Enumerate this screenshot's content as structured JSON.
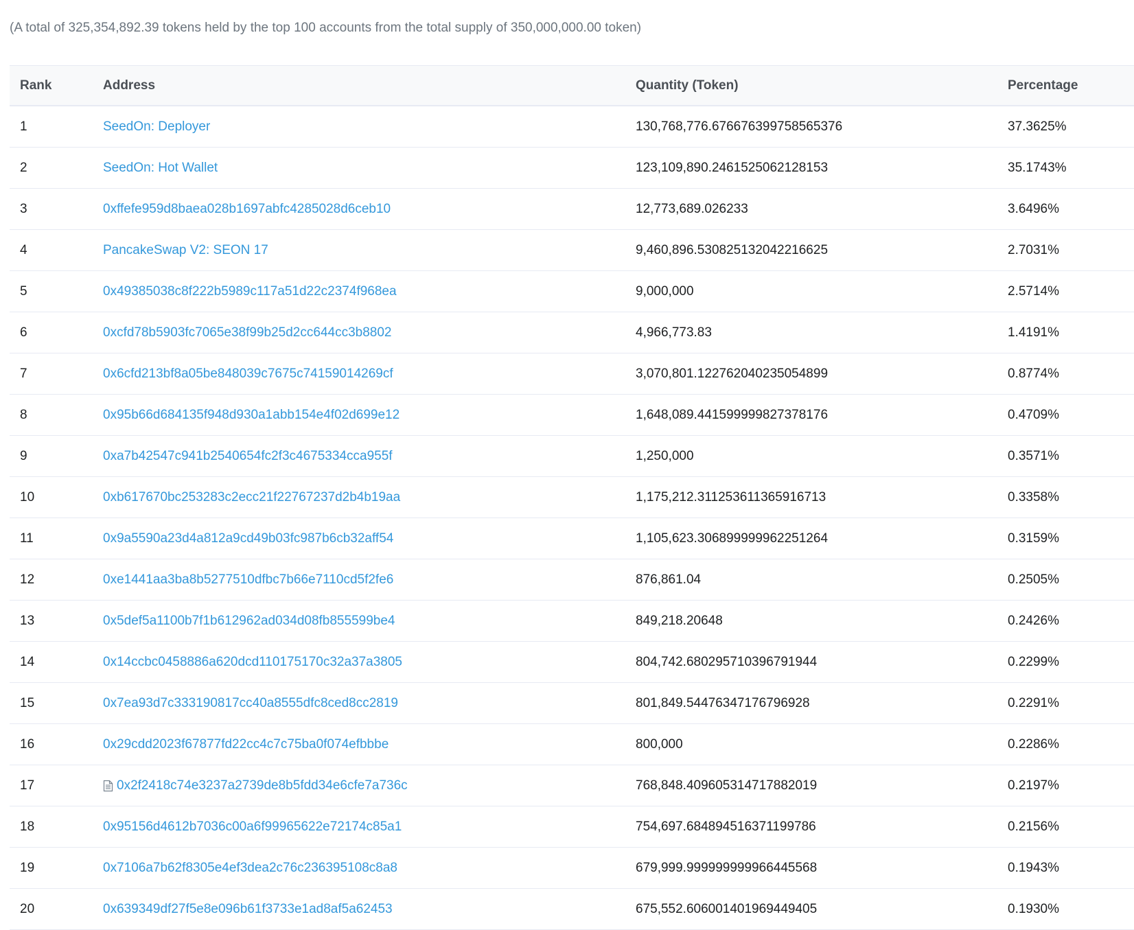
{
  "summary": "(A total of 325,354,892.39 tokens held by the top 100 accounts from the total supply of 350,000,000.00 token)",
  "table": {
    "headers": {
      "rank": "Rank",
      "address": "Address",
      "quantity": "Quantity (Token)",
      "percentage": "Percentage"
    },
    "rows": [
      {
        "rank": "1",
        "address": "SeedOn: Deployer",
        "quantity": "130,768,776.676676399758565376",
        "percentage": "37.3625%",
        "icon": ""
      },
      {
        "rank": "2",
        "address": "SeedOn: Hot Wallet",
        "quantity": "123,109,890.2461525062128153",
        "percentage": "35.1743%",
        "icon": ""
      },
      {
        "rank": "3",
        "address": "0xffefe959d8baea028b1697abfc4285028d6ceb10",
        "quantity": "12,773,689.026233",
        "percentage": "3.6496%",
        "icon": ""
      },
      {
        "rank": "4",
        "address": "PancakeSwap V2: SEON 17",
        "quantity": "9,460,896.530825132042216625",
        "percentage": "2.7031%",
        "icon": ""
      },
      {
        "rank": "5",
        "address": "0x49385038c8f222b5989c117a51d22c2374f968ea",
        "quantity": "9,000,000",
        "percentage": "2.5714%",
        "icon": ""
      },
      {
        "rank": "6",
        "address": "0xcfd78b5903fc7065e38f99b25d2cc644cc3b8802",
        "quantity": "4,966,773.83",
        "percentage": "1.4191%",
        "icon": ""
      },
      {
        "rank": "7",
        "address": "0x6cfd213bf8a05be848039c7675c74159014269cf",
        "quantity": "3,070,801.122762040235054899",
        "percentage": "0.8774%",
        "icon": ""
      },
      {
        "rank": "8",
        "address": "0x95b66d684135f948d930a1abb154e4f02d699e12",
        "quantity": "1,648,089.441599999827378176",
        "percentage": "0.4709%",
        "icon": ""
      },
      {
        "rank": "9",
        "address": "0xa7b42547c941b2540654fc2f3c4675334cca955f",
        "quantity": "1,250,000",
        "percentage": "0.3571%",
        "icon": ""
      },
      {
        "rank": "10",
        "address": "0xb617670bc253283c2ecc21f22767237d2b4b19aa",
        "quantity": "1,175,212.311253611365916713",
        "percentage": "0.3358%",
        "icon": ""
      },
      {
        "rank": "11",
        "address": "0x9a5590a23d4a812a9cd49b03fc987b6cb32aff54",
        "quantity": "1,105,623.306899999962251264",
        "percentage": "0.3159%",
        "icon": ""
      },
      {
        "rank": "12",
        "address": "0xe1441aa3ba8b5277510dfbc7b66e7110cd5f2fe6",
        "quantity": "876,861.04",
        "percentage": "0.2505%",
        "icon": ""
      },
      {
        "rank": "13",
        "address": "0x5def5a1100b7f1b612962ad034d08fb855599be4",
        "quantity": "849,218.20648",
        "percentage": "0.2426%",
        "icon": ""
      },
      {
        "rank": "14",
        "address": "0x14ccbc0458886a620dcd110175170c32a37a3805",
        "quantity": "804,742.680295710396791944",
        "percentage": "0.2299%",
        "icon": ""
      },
      {
        "rank": "15",
        "address": "0x7ea93d7c333190817cc40a8555dfc8ced8cc2819",
        "quantity": "801,849.54476347176796928",
        "percentage": "0.2291%",
        "icon": ""
      },
      {
        "rank": "16",
        "address": "0x29cdd2023f67877fd22cc4c7c75ba0f074efbbbe",
        "quantity": "800,000",
        "percentage": "0.2286%",
        "icon": ""
      },
      {
        "rank": "17",
        "address": "0x2f2418c74e3237a2739de8b5fdd34e6cfe7a736c",
        "quantity": "768,848.409605314717882019",
        "percentage": "0.2197%",
        "icon": "contract-icon"
      },
      {
        "rank": "18",
        "address": "0x95156d4612b7036c00a6f99965622e72174c85a1",
        "quantity": "754,697.684894516371199786",
        "percentage": "0.2156%",
        "icon": ""
      },
      {
        "rank": "19",
        "address": "0x7106a7b62f8305e4ef3dea2c76c236395108c8a8",
        "quantity": "679,999.999999999966445568",
        "percentage": "0.1943%",
        "icon": ""
      },
      {
        "rank": "20",
        "address": "0x639349df27f5e8e096b61f3733e1ad8af5a62453",
        "quantity": "675,552.606001401969449405",
        "percentage": "0.1930%",
        "icon": ""
      }
    ]
  }
}
